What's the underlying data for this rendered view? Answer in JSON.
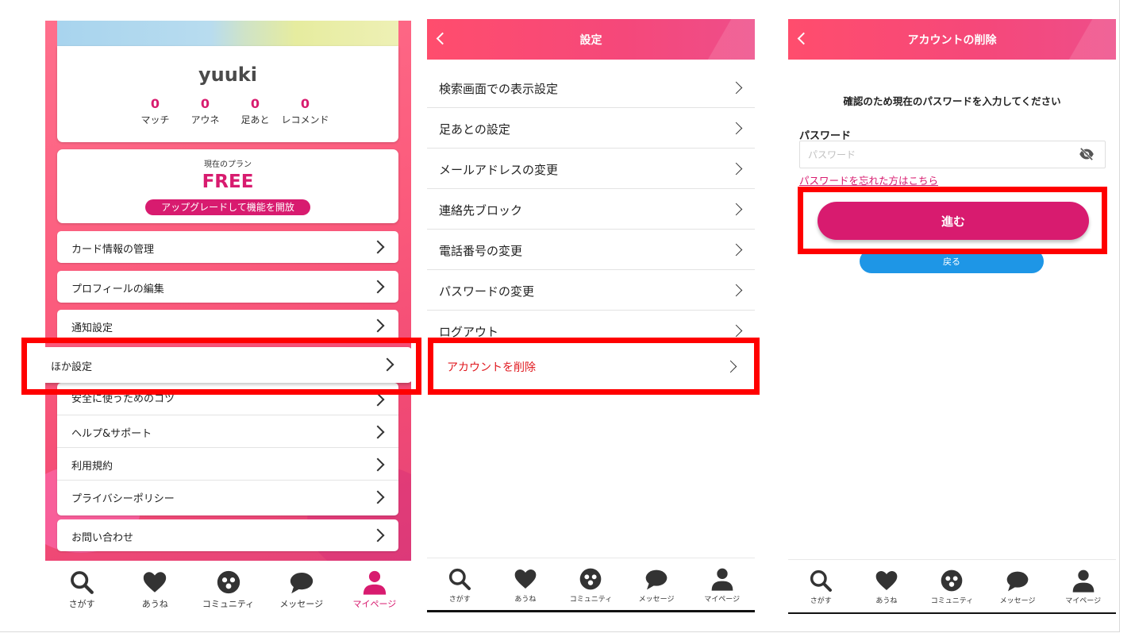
{
  "colors": {
    "brand_pink": "#d81b6f",
    "danger_red": "#e0191f",
    "highlight_red": "#ff0000",
    "back_blue": "#1e96e6"
  },
  "mypage": {
    "username": "yuuki",
    "stats": [
      {
        "count": "0",
        "label": "マッチ"
      },
      {
        "count": "0",
        "label": "アウネ"
      },
      {
        "count": "0",
        "label": "足あと"
      },
      {
        "count": "0",
        "label": "レコメンド"
      }
    ],
    "plan": {
      "label": "現在のプラン",
      "name": "FREE",
      "upgrade_label": "アップグレードして機能を開放"
    },
    "menu": [
      {
        "label": "カード情報の管理"
      },
      {
        "label": "プロフィールの編集"
      },
      {
        "label": "通知設定"
      }
    ],
    "highlighted_item": {
      "label": "ほか設定"
    },
    "group_menu": [
      {
        "label": "安全に使うためのコツ"
      },
      {
        "label": "ヘルプ&サポート"
      },
      {
        "label": "利用規約"
      },
      {
        "label": "プライバシーポリシー"
      }
    ],
    "contact": {
      "label": "お問い合わせ"
    }
  },
  "tabbar": [
    {
      "label": "さがす",
      "icon": "search-icon"
    },
    {
      "label": "あうね",
      "icon": "heart-icon"
    },
    {
      "label": "コミュニティ",
      "icon": "community-icon"
    },
    {
      "label": "メッセージ",
      "icon": "chat-bubble-icon"
    },
    {
      "label": "マイページ",
      "icon": "person-icon"
    }
  ],
  "settings": {
    "title": "設定",
    "items": [
      {
        "label": "検索画面での表示設定"
      },
      {
        "label": "足あとの設定"
      },
      {
        "label": "メールアドレスの変更"
      },
      {
        "label": "連絡先ブロック"
      },
      {
        "label": "電話番号の変更"
      },
      {
        "label": "パスワードの変更"
      },
      {
        "label": "ログアウト"
      },
      {
        "label": "アカウントを削除"
      }
    ]
  },
  "delete_account": {
    "title": "アカウントの削除",
    "instruction": "確認のため現在のパスワードを入力してください",
    "password_label": "パスワード",
    "password_placeholder": "パスワード",
    "forgot_link": "パスワードを忘れた方はこちら",
    "next_label": "進む",
    "back_label": "戻る"
  }
}
